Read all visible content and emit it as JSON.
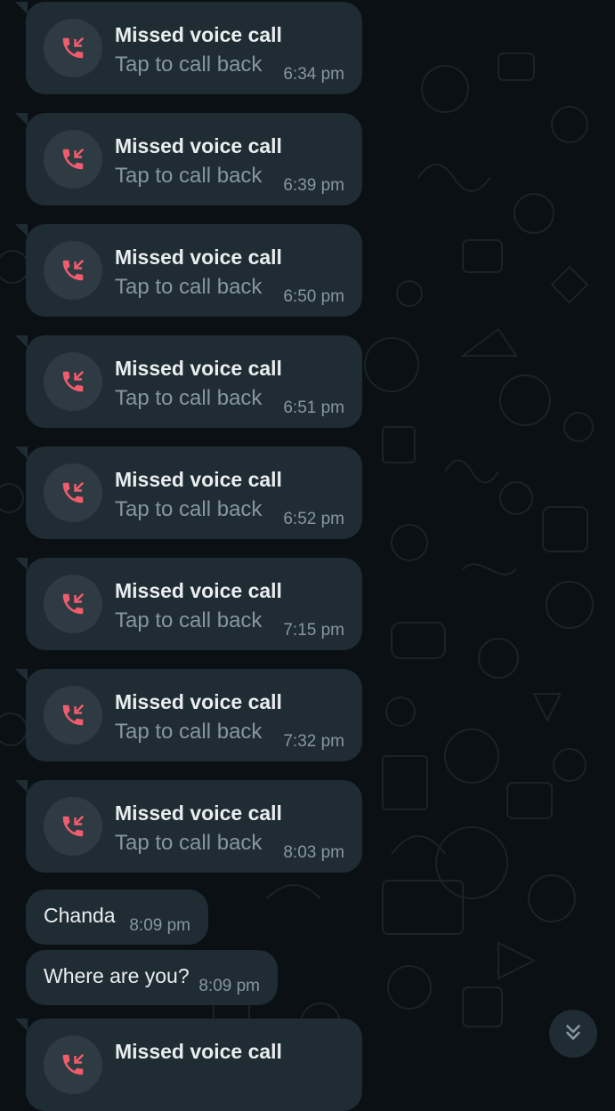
{
  "colors": {
    "background": "#0b1014",
    "bubble": "#202c33",
    "icon_circle": "#2f3b43",
    "missed_red": "#f15c6d",
    "primary_text": "#e9edef",
    "secondary_text": "#8696a0"
  },
  "missed_call": {
    "title": "Missed voice call",
    "subtitle": "Tap to call back",
    "icon": "missed-call-icon"
  },
  "messages": [
    {
      "type": "missed_call",
      "time": "6:34 pm"
    },
    {
      "type": "missed_call",
      "time": "6:39 pm"
    },
    {
      "type": "missed_call",
      "time": "6:50 pm"
    },
    {
      "type": "missed_call",
      "time": "6:51 pm"
    },
    {
      "type": "missed_call",
      "time": "6:52 pm"
    },
    {
      "type": "missed_call",
      "time": "7:15 pm"
    },
    {
      "type": "missed_call",
      "time": "7:32 pm"
    },
    {
      "type": "missed_call",
      "time": "8:03 pm"
    },
    {
      "type": "text",
      "text": "Chanda",
      "time": "8:09 pm"
    },
    {
      "type": "text",
      "text": "Where are you?",
      "time": "8:09 pm"
    },
    {
      "type": "missed_call",
      "time": "",
      "partial": true
    }
  ],
  "scroll_button": {
    "icon": "double-chevron-down-icon"
  }
}
